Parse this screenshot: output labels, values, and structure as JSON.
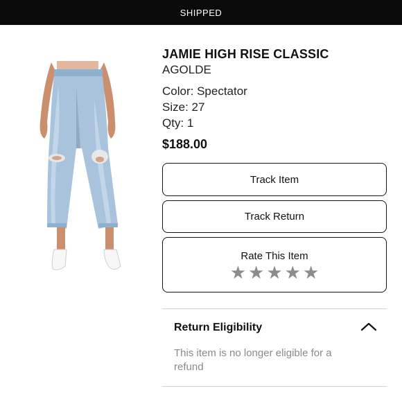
{
  "status_bar": {
    "label": "SHIPPED"
  },
  "product": {
    "name": "JAMIE HIGH RISE CLASSIC",
    "brand": "AGOLDE",
    "color": "Color: Spectator",
    "size": "Size: 27",
    "qty": "Qty: 1",
    "price": "$188.00"
  },
  "actions": {
    "track_item": "Track Item",
    "track_return": "Track Return",
    "rate_label": "Rate This Item",
    "rating_stars": 5,
    "rating_value": 0
  },
  "eligibility": {
    "title": "Return Eligibility",
    "text": "This item is no longer eligible for a refund",
    "toggle_icon": "chevron-up-icon"
  },
  "colors": {
    "status_bar_bg": "#0a0a0a",
    "star_inactive": "#8c8c8c",
    "muted_text": "#8a8a8a"
  }
}
